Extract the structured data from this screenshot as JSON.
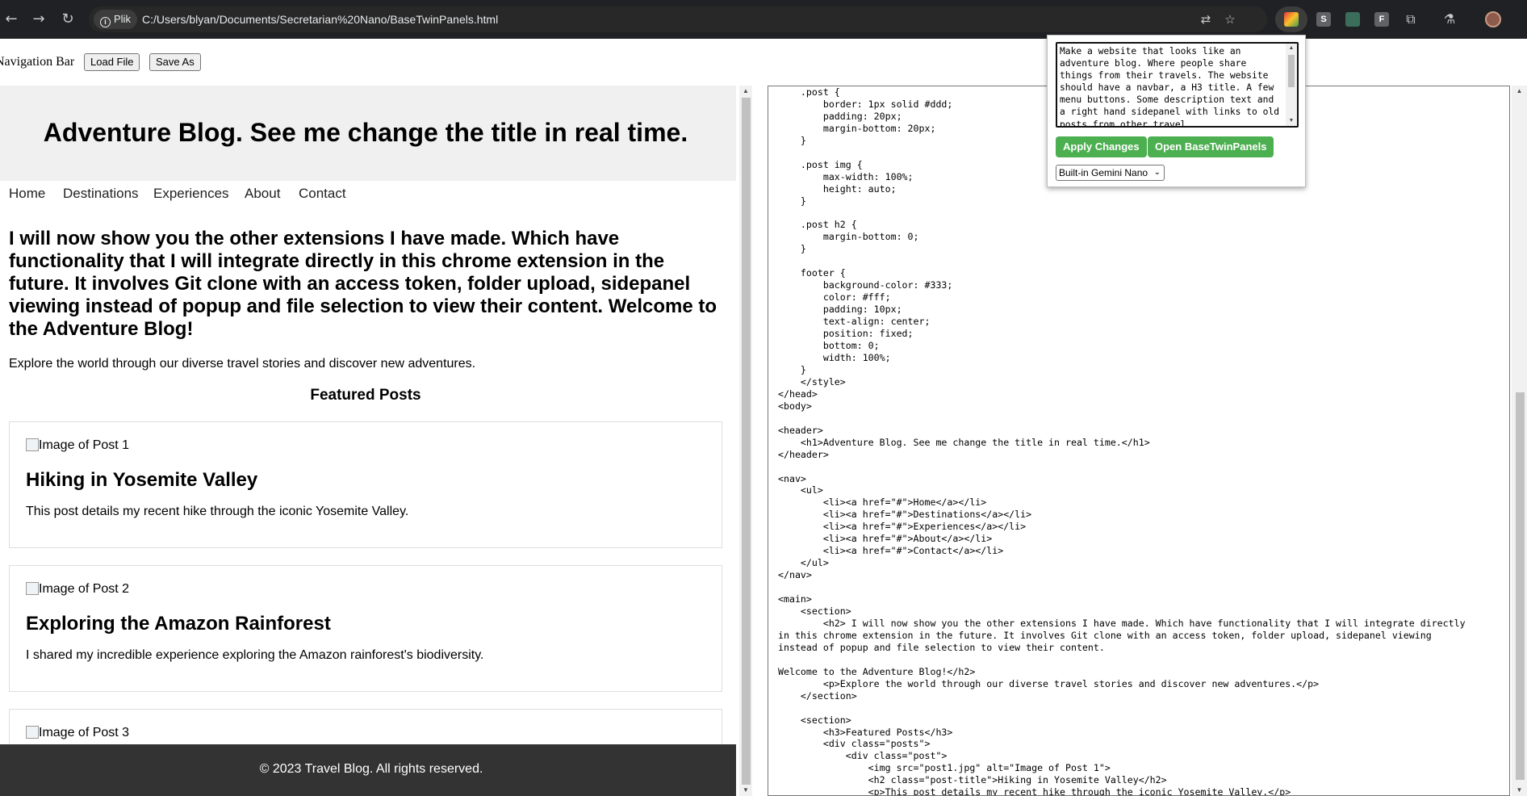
{
  "browser": {
    "site_chip": "Plik",
    "url": "C:/Users/blyan/Documents/Secretarian%20Nano/BaseTwinPanels.html",
    "extensions": [
      "S",
      "F"
    ]
  },
  "toolbar": {
    "nav_label": "Navigation Bar",
    "load_button": "Load File",
    "save_button": "Save As"
  },
  "preview": {
    "title": "Adventure Blog. See me change the title in real time.",
    "nav_items": [
      "Home",
      "Destinations",
      "Experiences",
      "About",
      "Contact"
    ],
    "heading": "I will now show you the other extensions I have made. Which have functionality that I will integrate directly in this chrome extension in the future. It involves Git clone with an access token, folder upload, sidepanel viewing instead of popup and file selection to view their content. Welcome to the Adventure Blog!",
    "intro": "Explore the world through our diverse travel stories and discover new adventures.",
    "featured_heading": "Featured Posts",
    "posts": [
      {
        "image_alt": "Image of Post 1",
        "title": "Hiking in Yosemite Valley",
        "description": "This post details my recent hike through the iconic Yosemite Valley."
      },
      {
        "image_alt": "Image of Post 2",
        "title": "Exploring the Amazon Rainforest",
        "description": "I shared my incredible experience exploring the Amazon rainforest's biodiversity."
      },
      {
        "image_alt": "Image of Post 3",
        "title": "",
        "description": ""
      }
    ],
    "footer": "© 2023 Travel Blog. All rights reserved."
  },
  "editor": {
    "code": "    .post {\n        border: 1px solid #ddd;\n        padding: 20px;\n        margin-bottom: 20px;\n    }\n\n    .post img {\n        max-width: 100%;\n        height: auto;\n    }\n\n    .post h2 {\n        margin-bottom: 0;\n    }\n\n    footer {\n        background-color: #333;\n        color: #fff;\n        padding: 10px;\n        text-align: center;\n        position: fixed;\n        bottom: 0;\n        width: 100%;\n    }\n    </style>\n</head>\n<body>\n\n<header>\n    <h1>Adventure Blog. See me change the title in real time.</h1>\n</header>\n\n<nav>\n    <ul>\n        <li><a href=\"#\">Home</a></li>\n        <li><a href=\"#\">Destinations</a></li>\n        <li><a href=\"#\">Experiences</a></li>\n        <li><a href=\"#\">About</a></li>\n        <li><a href=\"#\">Contact</a></li>\n    </ul>\n</nav>\n\n<main>\n    <section>\n        <h2> I will now show you the other extensions I have made. Which have functionality that I will integrate directly\nin this chrome extension in the future. It involves Git clone with an access token, folder upload, sidepanel viewing\ninstead of popup and file selection to view their content.\n\nWelcome to the Adventure Blog!</h2>\n        <p>Explore the world through our diverse travel stories and discover new adventures.</p>\n    </section>\n\n    <section>\n        <h3>Featured Posts</h3>\n        <div class=\"posts\">\n            <div class=\"post\">\n                <img src=\"post1.jpg\" alt=\"Image of Post 1\">\n                <h2 class=\"post-title\">Hiking in Yosemite Valley</h2>\n                <p>This post details my recent hike through the iconic Yosemite Valley.</p>"
  },
  "popup": {
    "prompt": "Make a website that looks like an adventure blog. Where people share things from their travels. The website should have a navbar, a H3 title. A few menu buttons. Some description text and a right hand sidepanel with links to old posts from other travel",
    "apply_button": "Apply Changes",
    "open_button": "Open BaseTwinPanels",
    "model_selected": "Built-in Gemini Nano",
    "accent_color": "#4caf50"
  }
}
